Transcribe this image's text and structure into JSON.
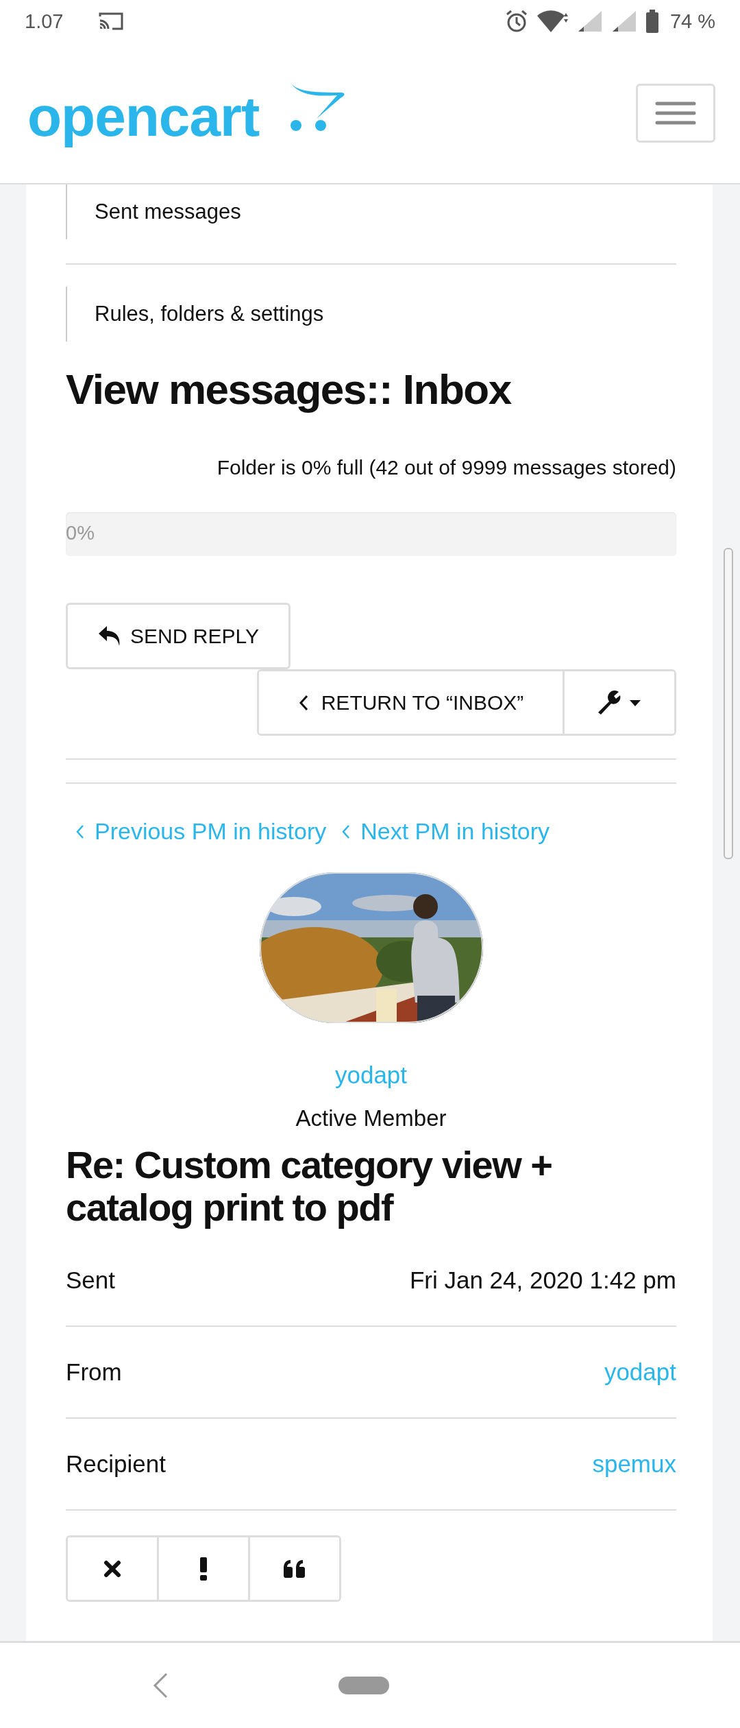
{
  "status_bar": {
    "time": "1.07",
    "battery": "74 %"
  },
  "header": {
    "logo": "opencart"
  },
  "nav_items": [
    {
      "label": "Sent messages"
    },
    {
      "label": "Rules, folders & settings"
    }
  ],
  "heading": "View messages:: Inbox",
  "folder_status": "Folder is 0% full (42 out of 9999 messages stored)",
  "progress": {
    "level": 0,
    "label": "0%"
  },
  "send_reply": "SEND REPLY",
  "return_button": "RETURN TO “INBOX”",
  "history_links": [
    "Previous PM in history",
    "Next PM in history"
  ],
  "author": {
    "name": "yodapt",
    "rank": "Active Member"
  },
  "subject": "Re: Custom category view + catalog print to pdf",
  "details": [
    {
      "label": "Sent",
      "value": "Fri Jan 24, 2020 1:42 pm",
      "kind": "text"
    },
    {
      "label": "From",
      "value": "yodapt",
      "kind": "link"
    },
    {
      "label": "Recipient",
      "value": "spemux",
      "kind": "link"
    }
  ]
}
